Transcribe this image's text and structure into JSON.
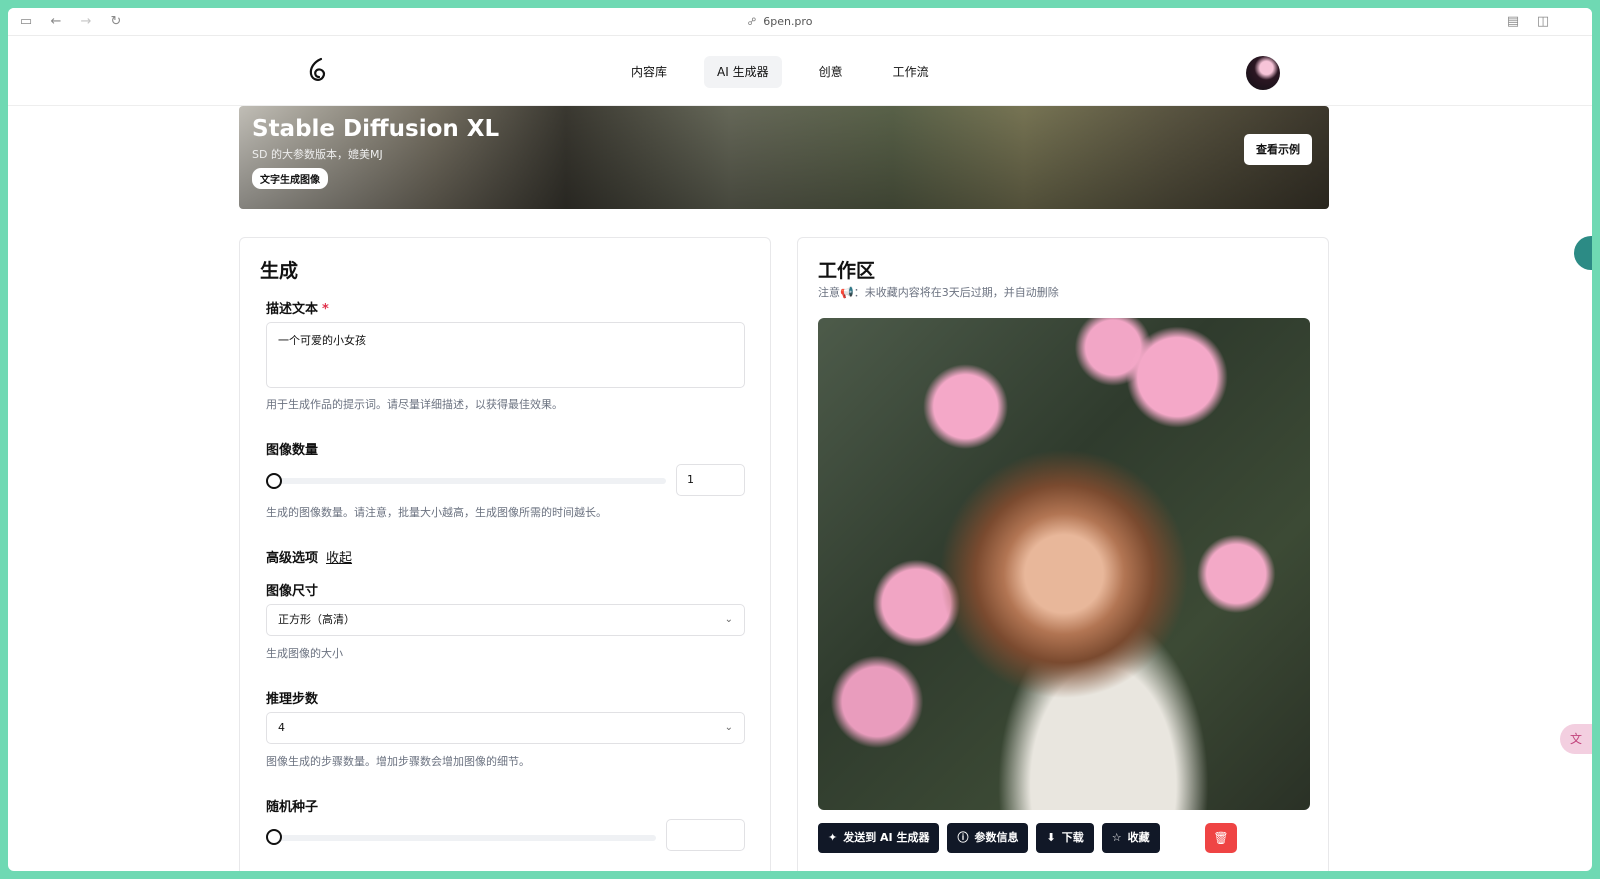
{
  "browser": {
    "url": "6pen.pro"
  },
  "nav": {
    "links": [
      "内容库",
      "AI 生成器",
      "创意",
      "工作流"
    ],
    "active_index": 1
  },
  "hero": {
    "title": "Stable Diffusion XL",
    "subtitle": "SD 的大参数版本，媲美MJ",
    "tag": "文字生成图像",
    "example_button": "查看示例"
  },
  "generate": {
    "title": "生成",
    "prompt_label": "描述文本",
    "required_mark": "*",
    "prompt_value": "一个可爱的小女孩",
    "prompt_hint": "用于生成作品的提示词。请尽量详细描述，以获得最佳效果。",
    "count_label": "图像数量",
    "count_value": "1",
    "count_hint": "生成的图像数量。请注意，批量大小越高，生成图像所需的时间越长。",
    "advanced_label": "高级选项",
    "collapse_link": "收起",
    "size_label": "图像尺寸",
    "size_value": "正方形（高清）",
    "size_hint": "生成图像的大小",
    "steps_label": "推理步数",
    "steps_value": "4",
    "steps_hint": "图像生成的步骤数量。增加步骤数会增加图像的细节。",
    "seed_label": "随机种子",
    "seed_value": ""
  },
  "workspace": {
    "title": "工作区",
    "note": "注意📢：未收藏内容将在3天后过期，并自动删除",
    "actions": [
      "发送到 AI 生成器",
      "参数信息",
      "下载",
      "收藏"
    ]
  },
  "colors": {
    "accent_dark": "#111827",
    "danger": "#ef4444",
    "frame": "#6fd9b3"
  }
}
